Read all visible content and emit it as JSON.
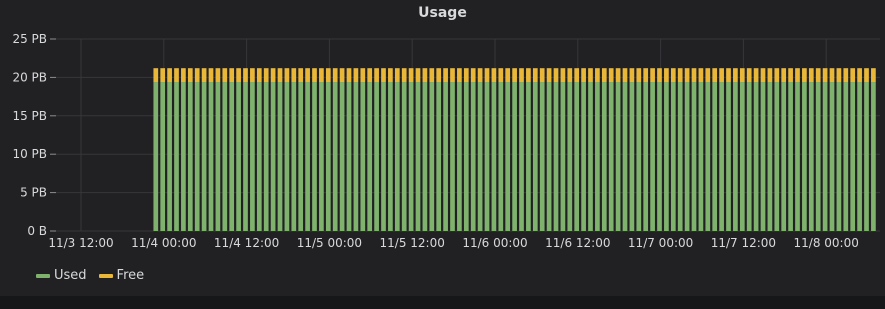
{
  "panel": {
    "title": "Usage"
  },
  "chart_data": {
    "type": "bar",
    "stacked": true,
    "title": "Usage",
    "y_ticks": [
      "0 B",
      "5 PB",
      "10 PB",
      "15 PB",
      "20 PB",
      "25 PB"
    ],
    "ylim": [
      0,
      25
    ],
    "x_ticks": [
      "11/3 12:00",
      "11/4 00:00",
      "11/4 12:00",
      "11/5 00:00",
      "11/5 12:00",
      "11/6 00:00",
      "11/6 12:00",
      "11/7 00:00",
      "11/7 12:00",
      "11/8 00:00"
    ],
    "x_range_hours": [
      0,
      132
    ],
    "x_start": "11/3 12:00",
    "bar_start_hour": 10.5,
    "bar_interval_hours": 1,
    "bar_count": 121,
    "series": [
      {
        "name": "Used",
        "color": "#7eb26d",
        "value": 19.4
      },
      {
        "name": "Free",
        "color": "#eab839",
        "value": 1.8
      }
    ],
    "grid": true,
    "legend_position": "bottom-left"
  }
}
